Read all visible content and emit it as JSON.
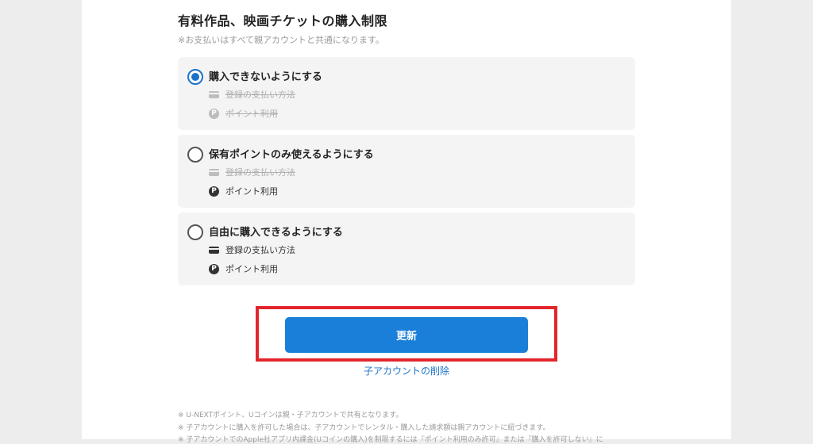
{
  "section": {
    "title": "有料作品、映画チケットの購入制限",
    "note": "※お支払いはすべて親アカウントと共通になります。"
  },
  "options": [
    {
      "label": "購入できないようにする",
      "selected": true,
      "features": [
        {
          "icon": "credit-card-icon",
          "text": "登録の支払い方法",
          "enabled": false
        },
        {
          "icon": "point-icon",
          "text": "ポイント利用",
          "enabled": false
        }
      ]
    },
    {
      "label": "保有ポイントのみ使えるようにする",
      "selected": false,
      "features": [
        {
          "icon": "credit-card-icon",
          "text": "登録の支払い方法",
          "enabled": false
        },
        {
          "icon": "point-icon",
          "text": "ポイント利用",
          "enabled": true
        }
      ]
    },
    {
      "label": "自由に購入できるようにする",
      "selected": false,
      "features": [
        {
          "icon": "credit-card-icon",
          "text": "登録の支払い方法",
          "enabled": true
        },
        {
          "icon": "point-icon",
          "text": "ポイント利用",
          "enabled": true
        }
      ]
    }
  ],
  "point_icon_glyph": "P",
  "actions": {
    "update_label": "更新",
    "delete_label": "子アカウントの削除"
  },
  "footnotes": [
    "※ U-NEXTポイント、Uコインは親・子アカウントで共有となります。",
    "※ 子アカウントに購入を許可した場合は、子アカウントでレンタル・購入した請求額は親アカウントに紐づきます。",
    "※ 子アカウントでのApple社アプリ内課金(Uコインの購入)を制限するには『ポイント利用のみ許可』または『購入を許可しない』に"
  ],
  "colors": {
    "accent": "#1a7fd9",
    "highlight": "#e3262c",
    "link": "#1a73c8"
  }
}
